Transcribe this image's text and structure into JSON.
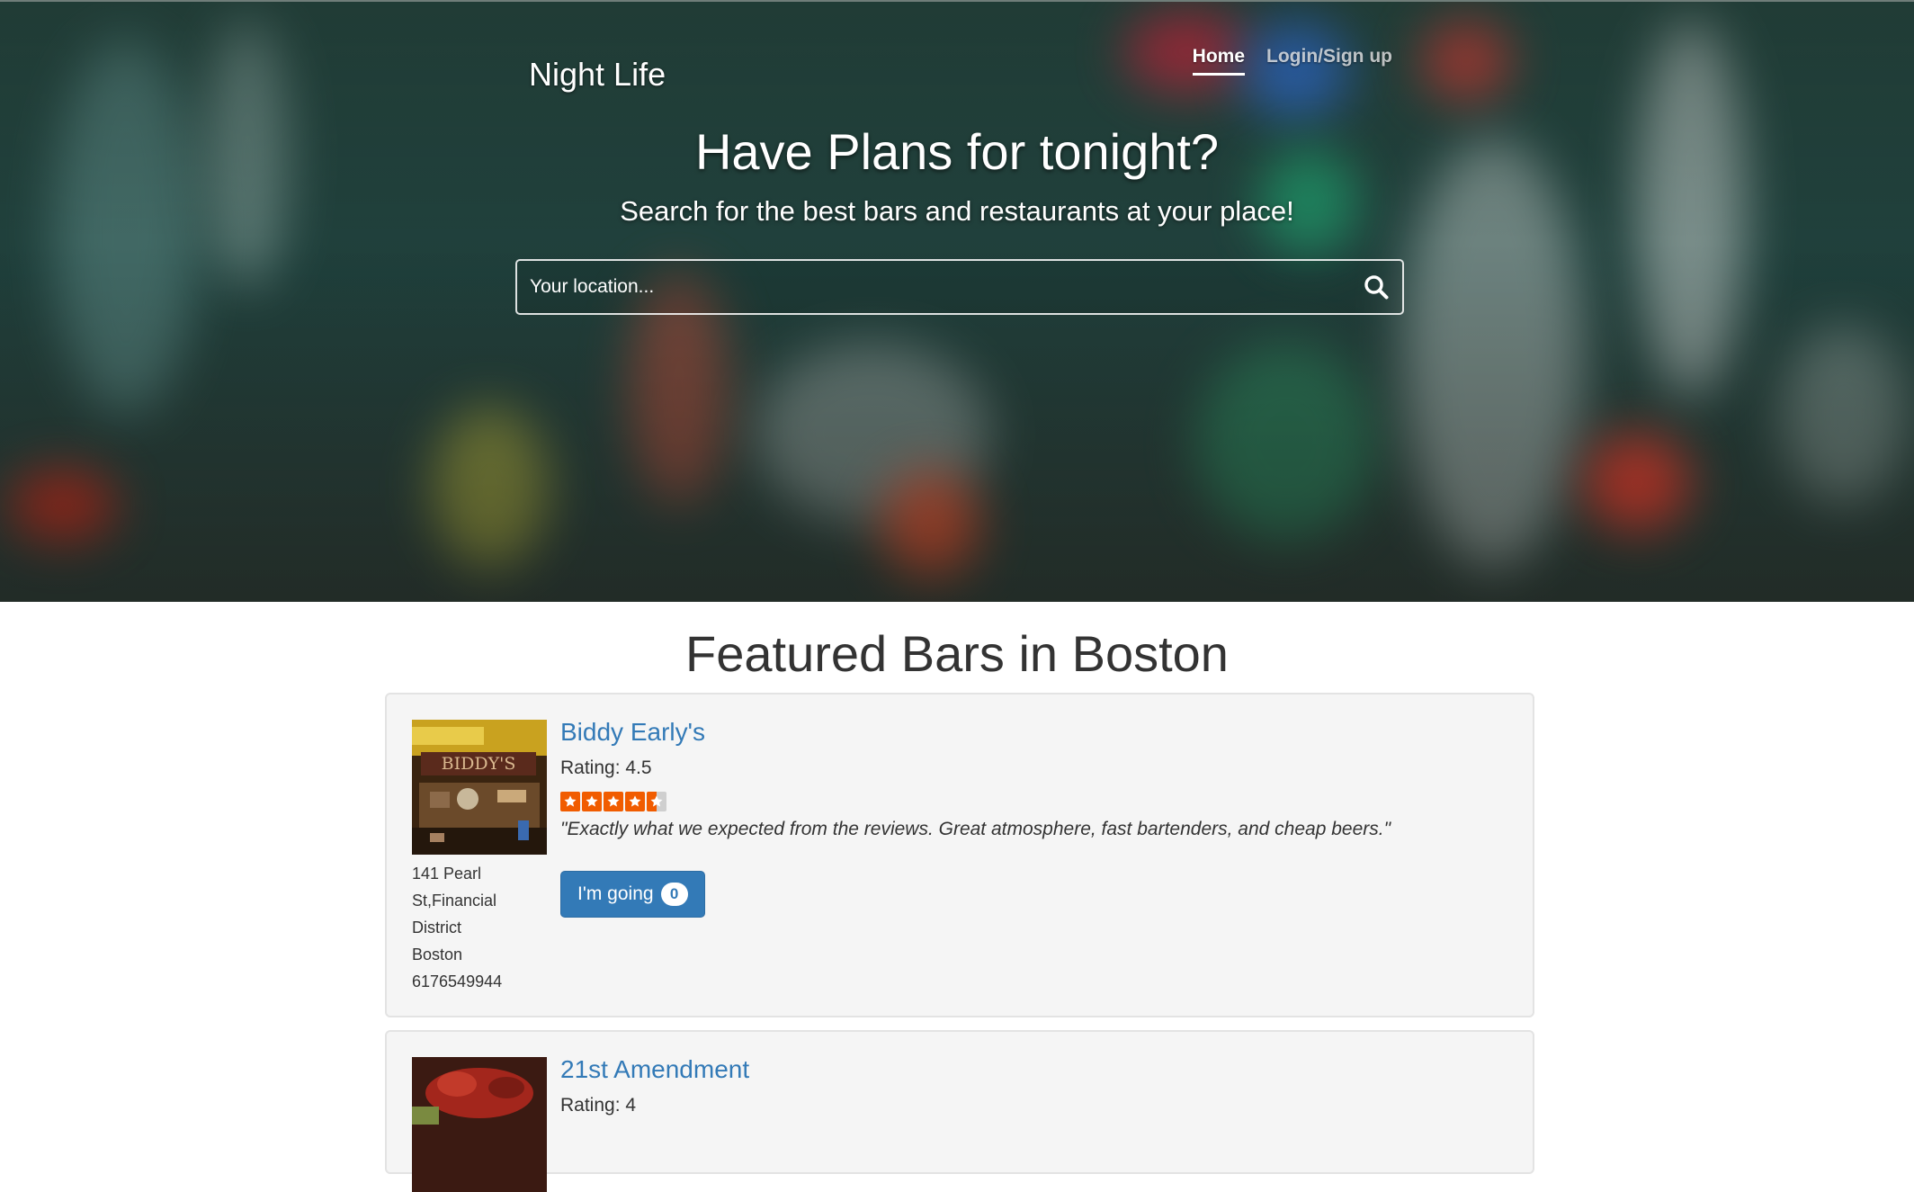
{
  "brand": "Night Life",
  "nav": {
    "home": "Home",
    "login": "Login/Sign up"
  },
  "hero": {
    "title": "Have Plans for tonight?",
    "subtitle": "Search for the best bars and restaurants at your place!",
    "search_placeholder": "Your location..."
  },
  "section_title": "Featured Bars in Boston",
  "bars": [
    {
      "name": "Biddy Early's",
      "rating": "Rating: 4.5",
      "stars": 4.5,
      "quote": "\"Exactly what we expected from the reviews. Great atmosphere, fast bartenders, and cheap beers.\"",
      "address": [
        "141 Pearl",
        "St,Financial",
        "District",
        "Boston",
        "6176549944"
      ],
      "going_label": "I'm going",
      "going_count": "0",
      "thumb_sign": "BIDDY'S"
    },
    {
      "name": "21st Amendment",
      "rating": "Rating: 4"
    }
  ],
  "colors": {
    "link": "#337ab7",
    "button": "#337ab7",
    "star": "#f15c00",
    "card_bg": "#f5f5f5"
  },
  "icons": {
    "search": "search-icon",
    "star": "star-icon"
  }
}
